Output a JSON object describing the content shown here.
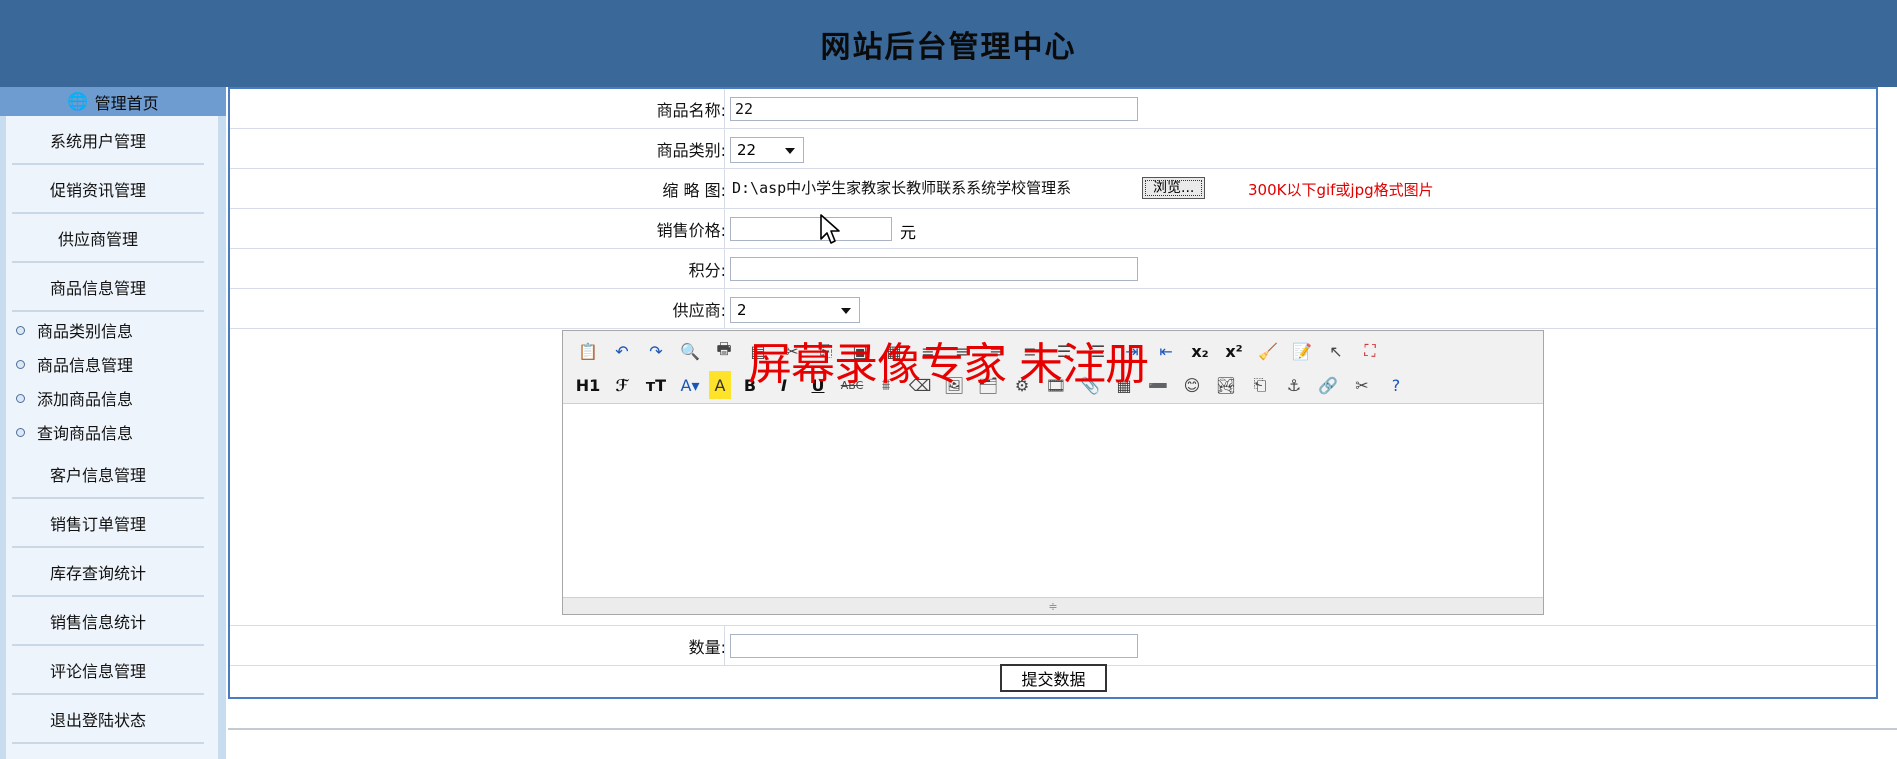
{
  "header": {
    "title": "网站后台管理中心"
  },
  "sidebar": {
    "home": "管理首页",
    "items": [
      "系统用户管理",
      "促销资讯管理",
      "供应商管理",
      "商品信息管理"
    ],
    "subitems": [
      "商品类别信息",
      "商品信息管理",
      "添加商品信息",
      "查询商品信息"
    ],
    "items_after": [
      "客户信息管理",
      "销售订单管理",
      "库存查询统计",
      "销售信息统计",
      "评论信息管理",
      "退出登陆状态"
    ]
  },
  "form": {
    "name_label": "商品名称:",
    "name_value": "22",
    "category_label": "商品类别:",
    "category_value": "22",
    "thumb_label": "缩 略 图:",
    "thumb_value": "D:\\asp中小学生家教家长教师联系系统学校管理系",
    "browse_label": "浏览...",
    "thumb_hint": "300K以下gif或jpg格式图片",
    "price_label": "销售价格:",
    "price_value": "",
    "price_unit": "元",
    "points_label": "积分:",
    "points_value": "",
    "supplier_label": "供应商:",
    "supplier_value": "2",
    "quantity_label": "数量:",
    "quantity_value": "",
    "submit_label": "提交数据"
  },
  "editor": {
    "row2_labels": {
      "heading": "H1",
      "font": "ℱ",
      "size": "тT",
      "bold": "B",
      "italic": "I",
      "underline": "U",
      "strike": "ABC"
    }
  },
  "watermark": "屏幕录像专家 未注册"
}
